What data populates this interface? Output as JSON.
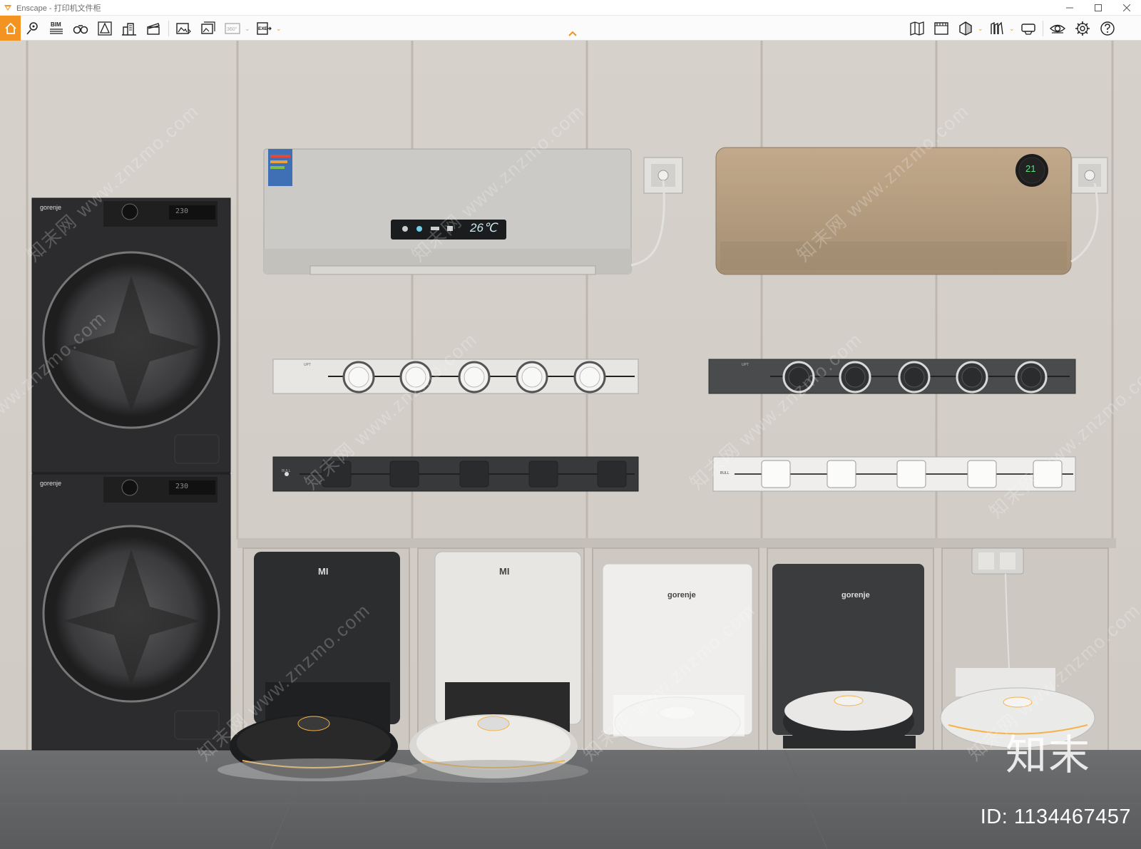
{
  "window": {
    "app_name": "Enscape",
    "separator": " - ",
    "document_name": "打印机文件柜",
    "controls": [
      "minimize",
      "maximize",
      "close"
    ]
  },
  "toolbar": {
    "left_icons": [
      "home-icon",
      "location-pin-icon",
      "bim-icon",
      "binoculars-icon",
      "perspective-icon",
      "buildings-icon",
      "clapperboard-icon",
      "render-image-icon",
      "batch-render-icon",
      "panorama-360-icon",
      "export-exe-icon"
    ],
    "bim_label": "BIM",
    "pano_label": "360°",
    "exe_label": "EXE",
    "right_icons": [
      "map-icon",
      "video-editor-icon",
      "shape-icon",
      "asset-library-icon",
      "vr-headset-icon",
      "visibility-icon",
      "settings-icon",
      "help-icon"
    ],
    "accent_color": "#f39322"
  },
  "scene": {
    "washer_brand": "gorenje",
    "washer_display": "230",
    "ac_left_temp": "26℃",
    "ac_right_temp": "21",
    "robot_brand_1": "MI",
    "robot_brand_2": "MI",
    "robot_brand_3": "gorenje",
    "robot_brand_4": "gorenje",
    "socket_brand_a": "UPT",
    "socket_brand_b": "BULL",
    "diagonal_watermark": "知末网 www.znzmo.com"
  },
  "watermark": {
    "logo_text": "知末",
    "id_text": "ID: 1134467457"
  }
}
